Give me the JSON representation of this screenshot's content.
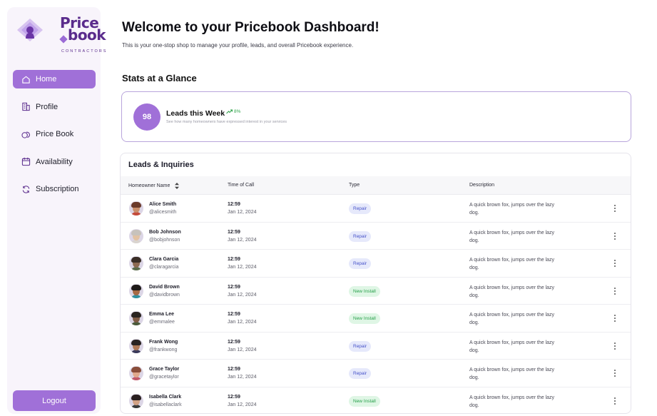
{
  "brand": {
    "line1": "Price",
    "line2": "book",
    "sub": "CONTRACTORS",
    "accent": "#a070d8",
    "dark": "#5a2b8c"
  },
  "sidebar": {
    "items": [
      {
        "label": "Home",
        "icon": "home-icon",
        "active": true
      },
      {
        "label": "Profile",
        "icon": "building-icon",
        "active": false
      },
      {
        "label": "Price Book",
        "icon": "coins-icon",
        "active": false
      },
      {
        "label": "Availability",
        "icon": "calendar-icon",
        "active": false
      },
      {
        "label": "Subscription",
        "icon": "refresh-icon",
        "active": false
      }
    ],
    "logout_label": "Logout"
  },
  "header": {
    "title": "Welcome to your Pricebook Dashboard!",
    "subtitle": "This is your one-stop shop to manage your profile, leads, and overall Pricebook experience."
  },
  "stats": {
    "section_title": "Stats at a Glance",
    "card": {
      "value": "98",
      "title": "Leads this Week",
      "delta": "8%",
      "description": "See how many homeowners have expressed interest in your services"
    }
  },
  "leads": {
    "title": "Leads & Inquiries",
    "columns": [
      "Homeowner Name",
      "Time of Call",
      "Type",
      "Description"
    ],
    "rows": [
      {
        "name": "Alice Smith",
        "handle": "@alicesmith",
        "time": "12:59",
        "date": "Jan 12, 2024",
        "type": "Repair",
        "desc": "A quick brown fox, jumps over the lazy dog."
      },
      {
        "name": "Bob Johnson",
        "handle": "@bobjohnson",
        "time": "12:59",
        "date": "Jan 12, 2024",
        "type": "Repair",
        "desc": "A quick brown fox, jumps over the lazy dog."
      },
      {
        "name": "Clara Garcia",
        "handle": "@claragarcia",
        "time": "12:59",
        "date": "Jan 12, 2024",
        "type": "Repair",
        "desc": "A quick brown fox, jumps over the lazy dog."
      },
      {
        "name": "David Brown",
        "handle": "@davidbrown",
        "time": "12:59",
        "date": "Jan 12, 2024",
        "type": "New Install",
        "desc": "A quick brown fox, jumps over the lazy dog."
      },
      {
        "name": "Emma Lee",
        "handle": "@emmalee",
        "time": "12:59",
        "date": "Jan 12, 2024",
        "type": "New Install",
        "desc": "A quick brown fox, jumps over the lazy dog."
      },
      {
        "name": "Frank Wong",
        "handle": "@frankwong",
        "time": "12:59",
        "date": "Jan 12, 2024",
        "type": "Repair",
        "desc": "A quick brown fox, jumps over the lazy dog."
      },
      {
        "name": "Grace Taylor",
        "handle": "@gracetaylor",
        "time": "12:59",
        "date": "Jan 12, 2024",
        "type": "Repair",
        "desc": "A quick brown fox, jumps over the lazy dog."
      },
      {
        "name": "Isabella Clark",
        "handle": "@isabellaclark",
        "time": "12:59",
        "date": "Jan 12, 2024",
        "type": "New Install",
        "desc": "A quick brown fox, jumps over the lazy dog."
      }
    ]
  }
}
